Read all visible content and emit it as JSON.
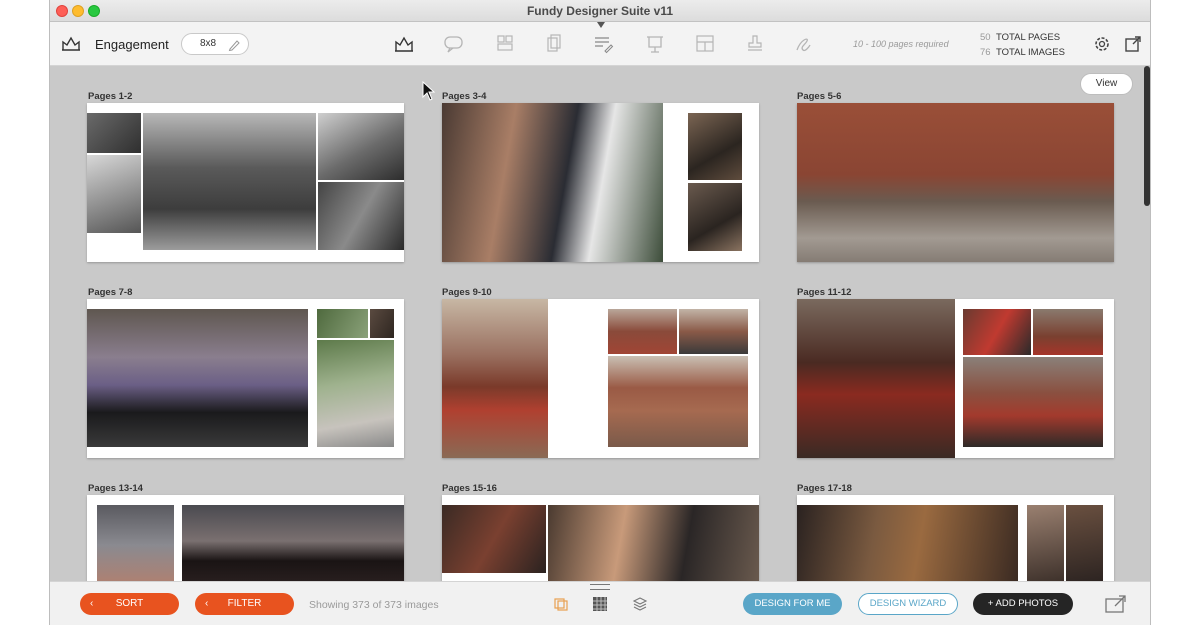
{
  "window": {
    "title": "Fundy Designer Suite v11"
  },
  "toolbar": {
    "album_name": "Engagement",
    "album_size": "8x8",
    "tools": [
      "album-icon",
      "speech-bubble-icon",
      "layout-icon",
      "pages-icon",
      "text-edit-icon",
      "presentation-icon",
      "grid-layout-icon",
      "stamp-icon",
      "signature-icon"
    ],
    "pages_required": "10 - 100 pages required",
    "total_pages_num": "50",
    "total_pages_label": "TOTAL PAGES",
    "total_images_num": "76",
    "total_images_label": "TOTAL IMAGES"
  },
  "canvas": {
    "view_label": "View",
    "spreads": [
      {
        "label": "Pages 1-2"
      },
      {
        "label": "Pages 3-4"
      },
      {
        "label": "Pages 5-6"
      },
      {
        "label": "Pages 7-8"
      },
      {
        "label": "Pages 9-10"
      },
      {
        "label": "Pages 11-12"
      },
      {
        "label": "Pages 13-14"
      },
      {
        "label": "Pages 15-16"
      },
      {
        "label": "Pages 17-18"
      }
    ]
  },
  "bottombar": {
    "sort_label": "SORT",
    "filter_label": "FILTER",
    "showing_text": "Showing 373 of 373 images",
    "design_for_me": "DESIGN FOR ME",
    "design_wizard": "DESIGN WIZARD",
    "add_photos": "+ ADD PHOTOS"
  },
  "colors": {
    "accent_orange": "#e8531f",
    "accent_blue": "#5aa6c8",
    "dark_button": "#252525"
  }
}
